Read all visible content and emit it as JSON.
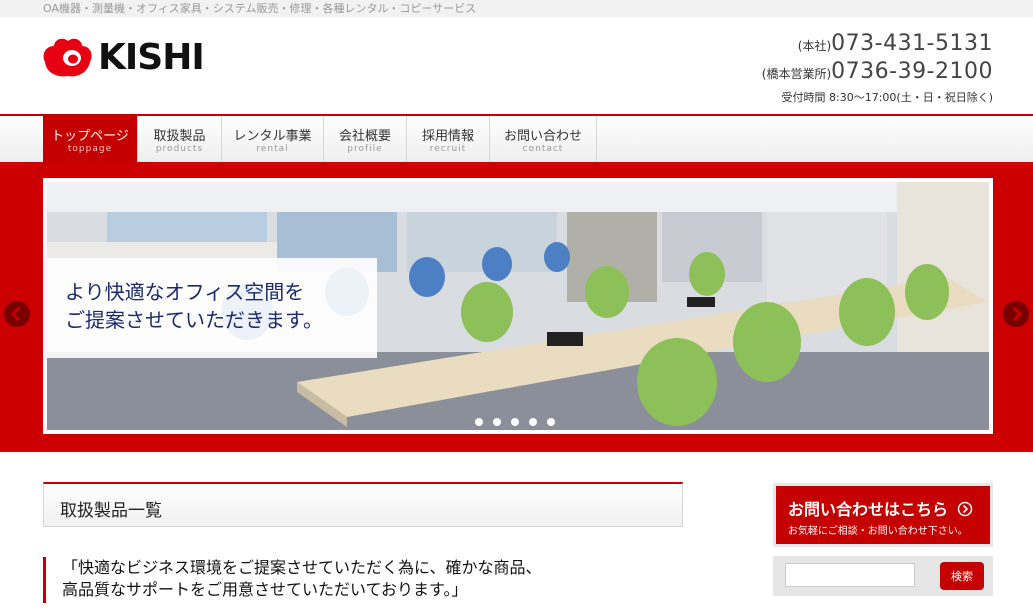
{
  "topbar": {
    "text": "OA機器・測量機・オフィス家具・システム販売・修理・各種レンタル・コピーサービス"
  },
  "logo": {
    "text": "KISHI"
  },
  "contact": {
    "phones": [
      {
        "label": "(本社)",
        "number": "073-431-5131"
      },
      {
        "label": "(橋本営業所)",
        "number": "0736-39-2100"
      }
    ],
    "hours": "受付時間 8:30〜17:00(土・日・祝日除く)"
  },
  "nav": [
    {
      "jp": "トップページ",
      "en": "toppage"
    },
    {
      "jp": "取扱製品",
      "en": "products"
    },
    {
      "jp": "レンタル事業",
      "en": "rental"
    },
    {
      "jp": "会社概要",
      "en": "profile"
    },
    {
      "jp": "採用情報",
      "en": "recruit"
    },
    {
      "jp": "お問い合わせ",
      "en": "contact"
    }
  ],
  "hero": {
    "caption_line1": "より快適なオフィス空間を",
    "caption_line2": "ご提案させていただきます。",
    "slide_count": 5,
    "active_slide": 1
  },
  "section": {
    "title": "取扱製品一覧"
  },
  "intro": {
    "line1": "「快適なビジネス環境をご提案させていただく為に、確かな商品、",
    "line2": "高品質なサポートをご用意させていただいております。」"
  },
  "cta": {
    "main": "お問い合わせはこちら",
    "sub": "お気軽にご相談・お問い合わせ下さい。"
  },
  "search": {
    "button": "検索",
    "placeholder": ""
  },
  "colors": {
    "brand_red": "#c40000",
    "hero_red": "#cc0000",
    "logo_red": "#e60012"
  }
}
